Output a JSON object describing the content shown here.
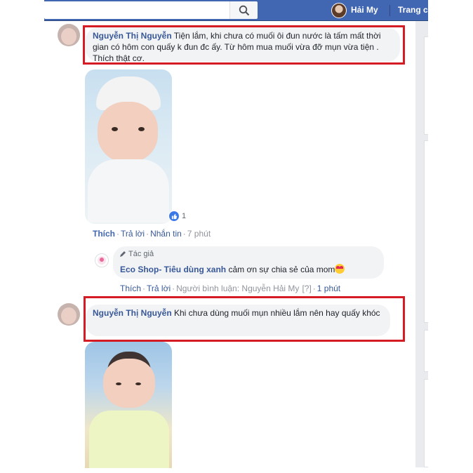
{
  "topbar": {
    "search_placeholder": "",
    "user_name": "Hải My",
    "home_label": "Trang chủ",
    "brand_color": "#4267b2"
  },
  "comments": [
    {
      "author": "Nguyễn Thị Nguyễn",
      "text": " Tiện lắm, khi chưa có muối ôi đun nước là tấm mất thời gian có hôm con quấy k đun đc ấy. Từ hôm mua muối vừa đỡ mụn vừa tiện . Thích thật cơ.",
      "reaction_count": "1",
      "actions": {
        "like": "Thích",
        "reply": "Trả lời",
        "message": "Nhắn tin",
        "time": "7 phút"
      },
      "reply": {
        "badge": "Tác giả",
        "author": "Eco Shop- Tiêu dùng xanh",
        "text": " cảm ơn sự chia sẻ của mom",
        "actions": {
          "like": "Thích",
          "reply": "Trả lời",
          "responder": "Người bình luận: Nguyễn Hải My",
          "help": "[?]",
          "time": "1 phút"
        }
      }
    },
    {
      "author": "Nguyễn Thị Nguyễn",
      "text": " Khi chưa dùng muối mụn nhiều lắm nên hay quấy khóc"
    }
  ]
}
